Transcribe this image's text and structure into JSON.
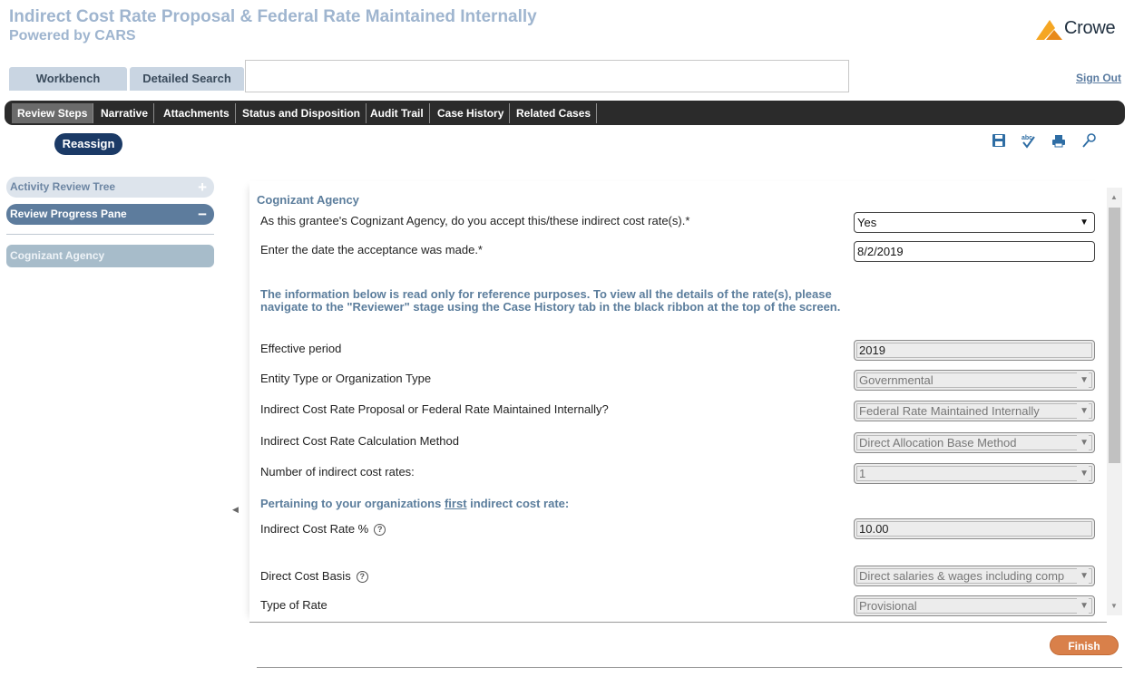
{
  "header": {
    "title": "Indirect Cost Rate Proposal & Federal Rate Maintained Internally",
    "subtitle": "Powered by CARS",
    "logo_text": "Crowe",
    "logo_color": "#f5a623"
  },
  "top_tabs": [
    "Workbench",
    "Detailed Search"
  ],
  "sign_out": "Sign Out",
  "ribbon_tabs": [
    "Review Steps",
    "Narrative",
    "Attachments",
    "Status and Disposition",
    "Audit Trail",
    "Case History",
    "Related Cases"
  ],
  "reassign_label": "Reassign",
  "toolbar_icons": [
    "save-icon",
    "spellcheck-icon",
    "print-icon",
    "zoom-icon"
  ],
  "left_pane": {
    "activity_tree": "Activity Review Tree",
    "activity_sign": "+",
    "progress_pane": "Review Progress Pane",
    "progress_sign": "−",
    "node": "Cognizant Agency"
  },
  "form": {
    "section_title": "Cognizant Agency",
    "accept_question": "As this grantee's Cognizant Agency, do you accept this/these indirect cost rate(s).*",
    "accept_value": "Yes",
    "date_question": "Enter the date the acceptance was made.*",
    "date_value": "8/2/2019",
    "info_note": "The information below is read only for reference purposes. To view all the details of the rate(s), please navigate to the \"Reviewer\" stage using the Case History tab in the black ribbon at the top of the screen.",
    "effective_period_label": "Effective period",
    "effective_period_value": "2019",
    "entity_type_label": "Entity Type or Organization Type",
    "entity_type_value": "Governmental",
    "proposal_type_label": "Indirect Cost Rate Proposal or Federal Rate Maintained Internally?",
    "proposal_type_value": "Federal Rate Maintained Internally",
    "calc_method_label": "Indirect Cost Rate Calculation Method",
    "calc_method_value": "Direct Allocation Base Method",
    "num_rates_label": "Number of indirect cost rates:",
    "num_rates_value": "1",
    "pertaining_prefix": "Pertaining to your organizations ",
    "pertaining_emph": "first",
    "pertaining_suffix": " indirect cost rate:",
    "rate_pct_label": "Indirect Cost Rate %",
    "rate_pct_value": "10.00",
    "cost_basis_label": "Direct Cost Basis",
    "cost_basis_value": "Direct salaries & wages including comp",
    "rate_type_label": "Type of Rate",
    "rate_type_value": "Provisional"
  },
  "finish_label": "Finish"
}
